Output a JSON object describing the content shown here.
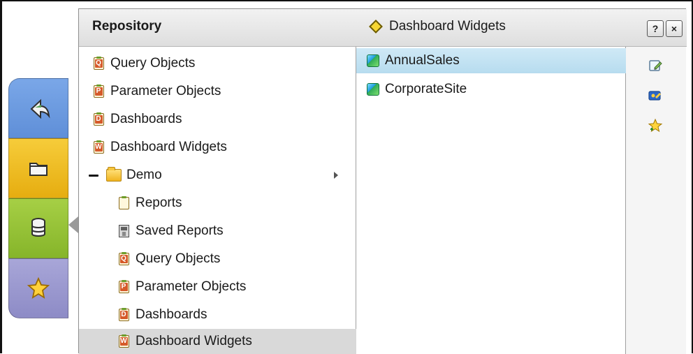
{
  "header": {
    "title": "Repository",
    "breadcrumb": "Dashboard Widgets",
    "help_label": "?",
    "close_label": "×"
  },
  "left_tabs": [
    {
      "icon": "back-arrow-icon",
      "color": "#6e9ddf"
    },
    {
      "icon": "folder-icon",
      "color": "#f0bd27"
    },
    {
      "icon": "database-icon",
      "color": "#95c13b"
    },
    {
      "icon": "star-icon",
      "color": "#9b99cf"
    }
  ],
  "tree": {
    "items": [
      {
        "label": "Query Objects"
      },
      {
        "label": "Parameter Objects"
      },
      {
        "label": "Dashboards"
      },
      {
        "label": "Dashboard Widgets"
      },
      {
        "label": "Demo"
      },
      {
        "label": "Reports"
      },
      {
        "label": "Saved Reports"
      },
      {
        "label": "Query Objects"
      },
      {
        "label": "Parameter Objects"
      },
      {
        "label": "Dashboards"
      },
      {
        "label": "Dashboard Widgets"
      }
    ]
  },
  "items": {
    "rows": [
      {
        "label": "AnnualSales"
      },
      {
        "label": "CorporateSite"
      }
    ]
  },
  "actions": [
    {
      "icon": "edit-icon"
    },
    {
      "icon": "share-icon"
    },
    {
      "icon": "add-favorite-icon"
    }
  ],
  "icon_letters": {
    "query": "Q",
    "parameter": "P",
    "dashboard": "D",
    "widget": "W"
  }
}
